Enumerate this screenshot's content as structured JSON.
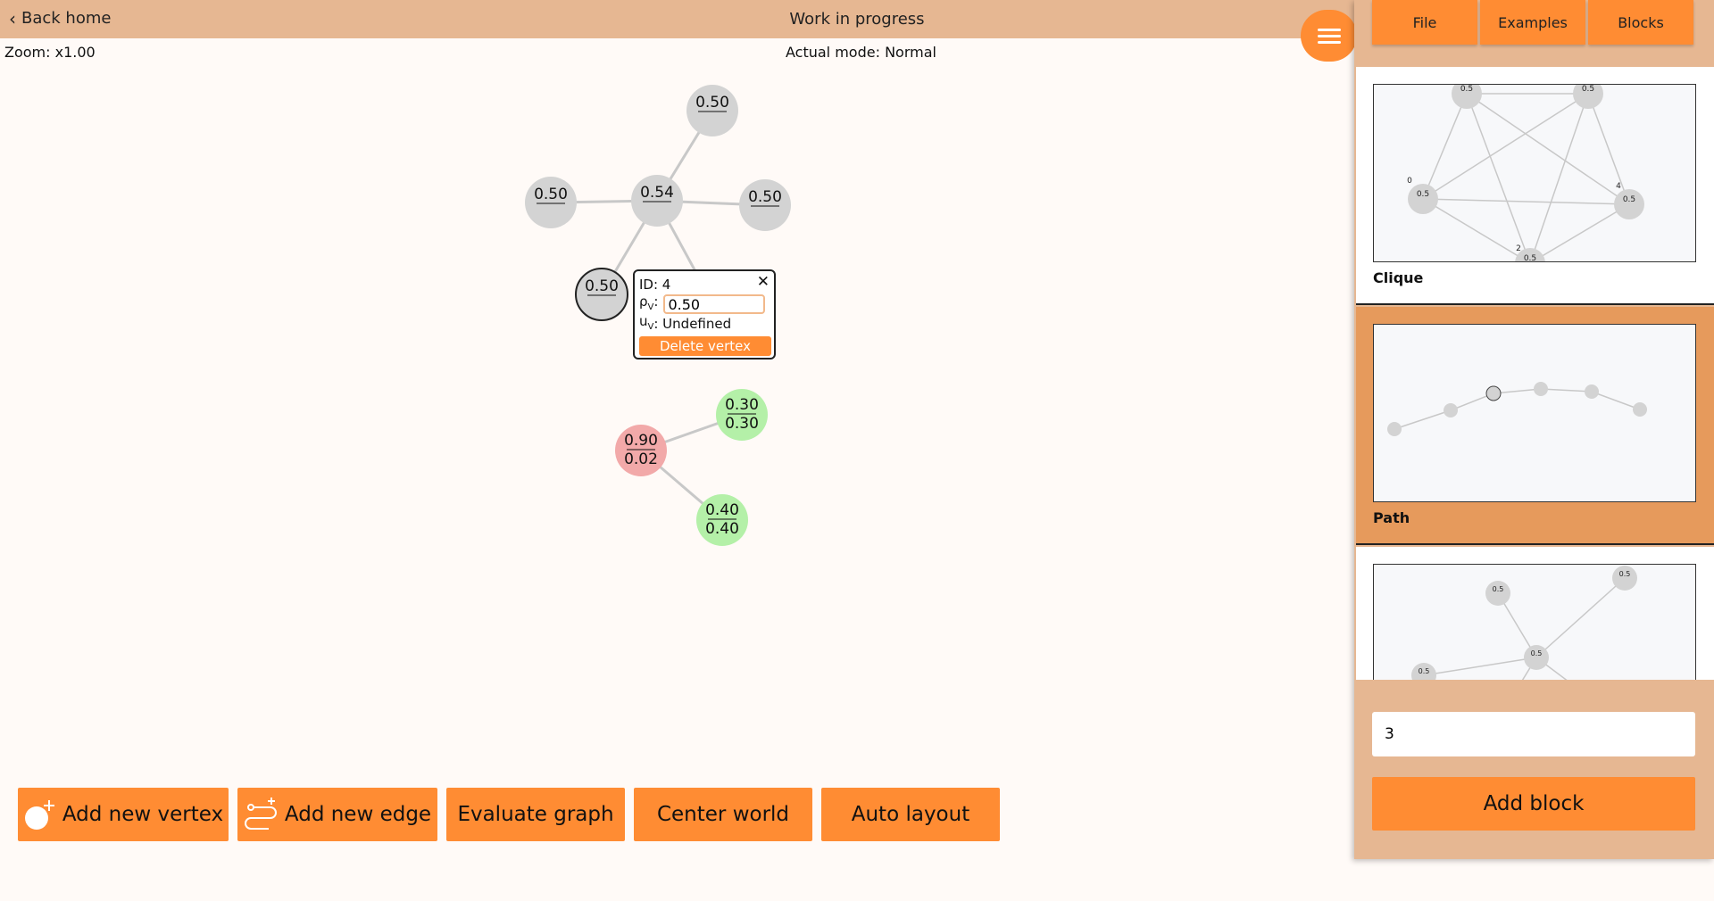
{
  "header": {
    "back_label": "Back home",
    "title": "Work in progress",
    "menu_icon": "hamburger-icon"
  },
  "status": {
    "zoom": "Zoom: x1.00",
    "mode": "Actual mode: Normal"
  },
  "graph": {
    "vertices": [
      {
        "id": "v-top",
        "top": "0.50",
        "bottom": "",
        "color": "#d3d3d3"
      },
      {
        "id": "v-left",
        "top": "0.50",
        "bottom": "",
        "color": "#d3d3d3"
      },
      {
        "id": "v-center",
        "top": "0.54",
        "bottom": "",
        "color": "#d3d3d3"
      },
      {
        "id": "v-right",
        "top": "0.50",
        "bottom": "",
        "color": "#d3d3d3"
      },
      {
        "id": "v-selected",
        "top": "0.50",
        "bottom": "",
        "color": "#d3d3d3"
      },
      {
        "id": "v-red",
        "top": "0.90",
        "bottom": "0.02",
        "color": "#f2a9a9"
      },
      {
        "id": "v-green-1",
        "top": "0.30",
        "bottom": "0.30",
        "color": "#b4f0a8"
      },
      {
        "id": "v-green-2",
        "top": "0.40",
        "bottom": "0.40",
        "color": "#b4f0a8"
      }
    ]
  },
  "popup": {
    "id_text": "ID: 4",
    "rho_label": "ρ",
    "u_label": "u",
    "sub_v": "V",
    "rho_value": "0.50",
    "u_value": ": Undefined",
    "delete_label": "Delete vertex",
    "close_symbol": "✕"
  },
  "toolbar": {
    "add_vertex": "Add new vertex",
    "add_edge": "Add new edge",
    "evaluate": "Evaluate graph",
    "center": "Center world",
    "auto_layout": "Auto layout"
  },
  "panel": {
    "tabs": [
      "File",
      "Examples",
      "Blocks"
    ],
    "blocks": [
      {
        "name": "Clique",
        "selected": false
      },
      {
        "name": "Path",
        "selected": true
      },
      {
        "name": "",
        "selected": false
      }
    ],
    "clique_labels": {
      "v0": "0",
      "v2": "2",
      "v4": "4",
      "val": "0.5"
    },
    "count_value": "3",
    "add_block_label": "Add block"
  },
  "colors": {
    "accent": "#ff8c33",
    "header_bg": "#e6b792",
    "selected_card": "#e69a5c"
  }
}
